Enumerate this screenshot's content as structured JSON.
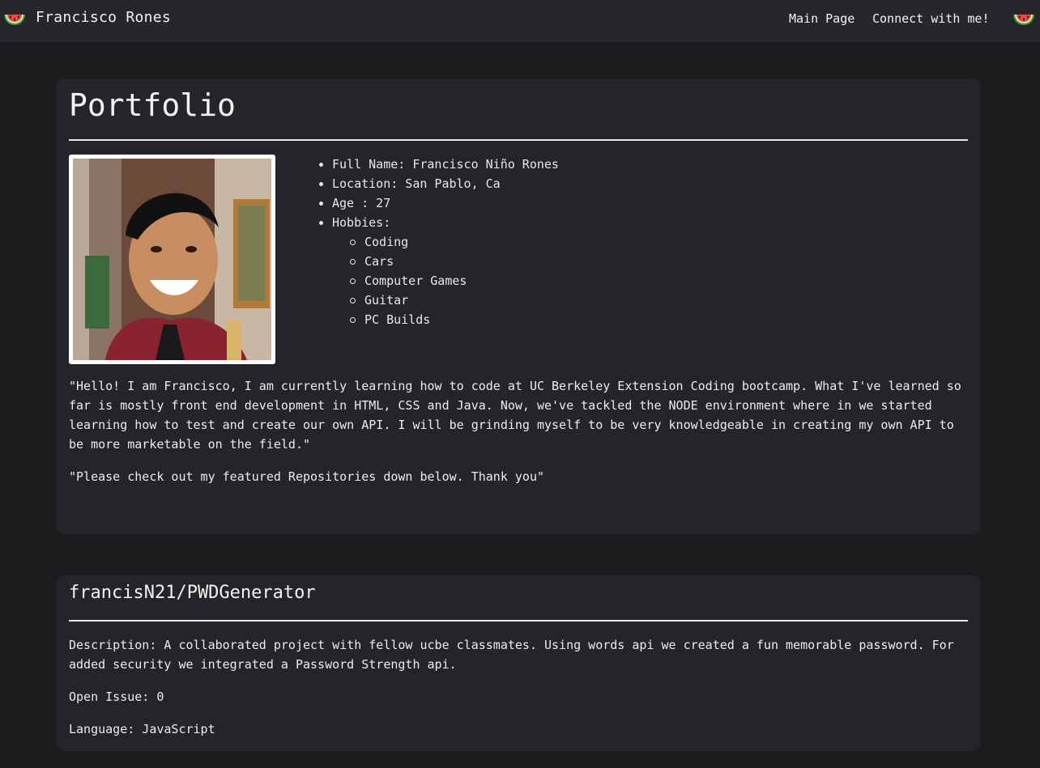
{
  "nav": {
    "brand": "Francisco Rones",
    "links": [
      "Main Page",
      "Connect with me!"
    ]
  },
  "profile": {
    "title": "Portfolio",
    "info": [
      "Full Name: Francisco Niño Rones",
      "Location: San Pablo, Ca",
      "Age : 27",
      "Hobbies:"
    ],
    "hobbies": [
      "Coding",
      "Cars",
      "Computer Games",
      "Guitar",
      "PC Builds"
    ],
    "bio": "\"Hello! I am Francisco, I am currently learning how to code at UC Berkeley Extension Coding bootcamp. What I've learned so far is mostly front end development in HTML, CSS and Java. Now, we've tackled the NODE environment where in we started learning how to test and create our own API. I will be grinding myself to be very knowledgeable in creating my own API to be more marketable on the field.\"",
    "note": "\"Please check out my featured Repositories down below. Thank you\""
  },
  "repos": [
    {
      "name": "francisN21/PWDGenerator",
      "description": "Description: A collaborated project with fellow ucbe classmates. Using words api we created a fun memorable password. For added security we integrated a Password Strength api.",
      "open_issues": "Open Issue: 0",
      "language": "Language: JavaScript"
    }
  ],
  "icons": {
    "logo": "watermelon-icon",
    "photo": "profile-photo"
  },
  "colors": {
    "page_bg": "#1b1c1e",
    "navbar_bg": "#25272a",
    "card_bg": "#242528",
    "text": "#e8e8e8"
  }
}
